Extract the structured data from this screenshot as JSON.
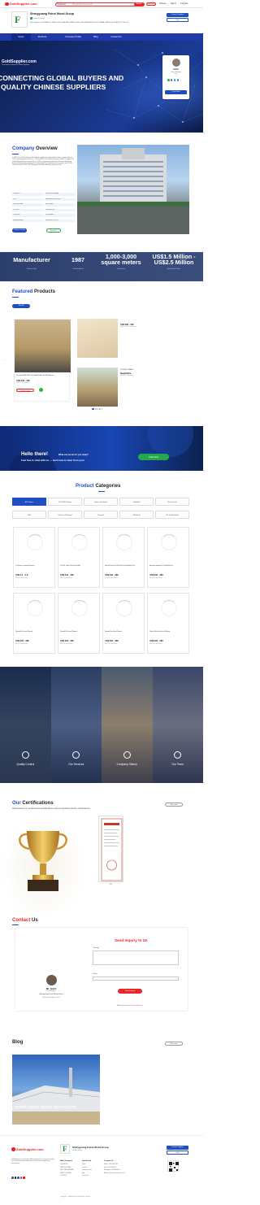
{
  "header": {
    "logo_text": "GoldSupplier.com",
    "logo_sub": "Thousands of Industrial & Global Suppliers",
    "search_select": "Products",
    "search_placeholder": "Please Enter Keywords",
    "search_button": "Search",
    "free_rfq": "Free RFQ",
    "links": [
      "Chinese",
      "Sign In",
      "Join Free"
    ]
  },
  "company": {
    "name": "Shengyuang Futrui Wood Group",
    "verified": "Verified Listing",
    "main_products": "Main Products: POPLAR LVL, PINE GLUDTLAM AND FRAME, MDF PLASTERBOARD DOOR FRAME, PARTICLE BOARD, PLYWOOD",
    "contact_btn": "Contact Supplier",
    "chat_btn": "Chat"
  },
  "nav": [
    "Home",
    "Products",
    "Company Profile",
    "Blog",
    "Contact Us"
  ],
  "hero": {
    "brand": "GoldSupplier.com",
    "brand_sub": "Thousands of Industrial & Global Suppliers",
    "headline_1": "CONNECTING GLOBAL BUYERS AND",
    "headline_2": "QUALITY CHINESE SUPPLIERS",
    "agent_name": "ALEX",
    "agent_role": "Sales Manager",
    "agent_flag": "China",
    "agent_btn": "Chat Now"
  },
  "overview": {
    "title_acc": "Company",
    "title_rest": " Overview",
    "text": "In 1987, Futrui Wood Group and Shandong's capable the wood-building furniture company Futrui. In 1991, the group joined with the first — Rimarei MDF, Futrui Wood Group was founded as suppliers for wood building furniture company Futrui. In 2002, the group entered the first CE-commended Great Furniture Development and started the leading Kiplo IDO. Standardized in accordance with ITOCEI Good-CEI and the DISCT. Well, Bringing forward ISN / BS&amp; plywood, ETFH...",
    "grid": [
      "POPLAR LVL",
      "PINE GLUED-LAM BEAM",
      "MDF",
      "PAPER FACED MDF BOARD",
      "PARTICLE BOARD",
      "BLOCKBOARD",
      "PLYWOOD",
      "CONSTRUCTION",
      "FURNITURE",
      "DOOR FRAME",
      "MELAMINE BOARD",
      "FILM FACED PLYWOOD"
    ],
    "btn_product": "Product Catalog",
    "btn_download": "Download"
  },
  "stats": [
    {
      "value": "Manufacturer",
      "label": "Business Type"
    },
    {
      "value": "1987",
      "label": "Year Established"
    },
    {
      "value": "1,000-3,000 square meters",
      "label": "Factory Size"
    },
    {
      "value": "US$1.5 Million - US$2.5 Million",
      "label": "Annual Export Value"
    }
  ],
  "featured": {
    "title_acc": "Featured",
    "title_rest": " Products",
    "view_all": "View All",
    "big": {
      "name": "Top Quality MDF E16 Pine Scaffold Planks JEP E10 Malaysia",
      "price": "US$ 300 - 300",
      "moq": "MOQ: 20 Cubic Meters",
      "rq": "Request Quote"
    },
    "small": [
      {
        "name": "",
        "price": "US$ 280 - 320",
        "moq": "MOQ: 20 Cubic Centimeters"
      },
      {
        "name": "LVL/PINE 1 BEAM 2",
        "price": "Negotiable",
        "moq": "MOQ: 20 Centimeters"
      }
    ]
  },
  "hello": {
    "title": "Hello there!",
    "subtitle": "What can we do for you today?",
    "line2": "Feel free to chat with us — we'd love to hear from you!",
    "btn": "Chat Now"
  },
  "categories": {
    "title_acc": "Product",
    "title_rest": " Categories",
    "tabs": [
      "All Products",
      "LVL/LVB/LVL Beam",
      "Poplar Lama Board",
      "Solid Bord",
      "Plastic Board",
      "MDF",
      "Film Faced Plywood",
      "Plywood",
      "OSB Board",
      "LVL Scaffold Plank"
    ],
    "cards": [
      {
        "name": "LVL Beam for Formwork Material",
        "price": "US$ 0.1 - 0.9",
        "moq": "MOQ: 20 Cubic Meters"
      },
      {
        "name": "LVL/OSL Timber Plank For Scaffold",
        "price": "US$ 340 - 380",
        "moq": "MOQ: 20 Cubic Meters"
      },
      {
        "name": "Manual Drop Rush LVB Plank For Scaffolding Plank",
        "price": "US$ 340 - 380",
        "moq": "MOQ: 20 Cubic Meters"
      },
      {
        "name": "Australian Standard LVL Scaffold Planks",
        "price": "US$ 300 - 380",
        "moq": "MOQ: 20 Cubic Meters"
      },
      {
        "name": "Plywood Film Faced Plywood",
        "price": "US$ 320 - 380",
        "moq": "MOQ: 20 Cubic Meters"
      },
      {
        "name": "Plywood Film Faced Plywood",
        "price": "US$ 320 - 380",
        "moq": "MOQ: 20 Cubic Meters"
      },
      {
        "name": "Plywood Film Faced Plywood",
        "price": "US$ 320 - 380",
        "moq": "MOQ: 20 Cubic Meters"
      },
      {
        "name": "18mm 100mm Film Faced Plywood",
        "price": "US$ 320 - 380",
        "moq": "MOQ: 20 Cubic Meters"
      }
    ]
  },
  "gallery": [
    "Quality Control",
    "Our Services",
    "Company History",
    "Our Team"
  ],
  "certs": {
    "title_acc": "Our",
    "title_rest": " Certifications",
    "subtitle": "Showcasing our professional qualifications and recognized industry certifications.",
    "view_all": "View more",
    "label": "FSC"
  },
  "contact": {
    "title_acc": "Contact",
    "title_rest": " Us",
    "name": "Mr. ALEX",
    "role": "Sales Manager",
    "company": "Shengyuang Futrui Wood Group",
    "location": "Weifang, Shandong, China",
    "form_title": "Send Inquiry to Us",
    "message_label": "* Message",
    "email_label": "* Email",
    "send_btn": "Send Inquiry",
    "chat_line": "Want the best price?",
    "chat_link": "Chat us Right now!"
  },
  "blog": {
    "title": "Blog",
    "view_all": "View more",
    "caption": "FUTRUI WOOD GROUP BIG FACTORY"
  },
  "footer": {
    "logo_text": "GoldSupplier.com",
    "company": "Shengyuang Futrui Wood Group",
    "verified": "Verified Listing",
    "contact_btn": "Contact Supplier",
    "chat_btn": "Chat",
    "about": "GoldSupplier.com is the leading B2B marketplace for sourcing from quality, connecting Global global buyers with verified Chinese suppliers and manufacturers.",
    "cols": [
      {
        "h": "Main Products",
        "items": [
          "POPLAR LVL",
          "PINE GLUDTLAM",
          "MDF PLASTERBOARD",
          "PARTICLE BOARD",
          "PLYWOOD"
        ]
      },
      {
        "h": "Quick Link",
        "items": [
          "Home",
          "Products",
          "Company Profile",
          "Blog",
          "Contact Us"
        ]
      },
      {
        "h": "Contact Us",
        "items": [
          "Mobile: +8615966918xx",
          "Phone: 86+53690903",
          "WhatsApp: +8615966918xx",
          "Address: Weifang, Shandong, China"
        ]
      }
    ],
    "copyright": "Copyright © GoldSupplier.com, All rights reserved."
  },
  "colors": {
    "brand_red": "#e8262b",
    "primary_blue": "#1f4ec2",
    "nav_blue": "#1f3aa8",
    "green": "#2a9d4a"
  }
}
